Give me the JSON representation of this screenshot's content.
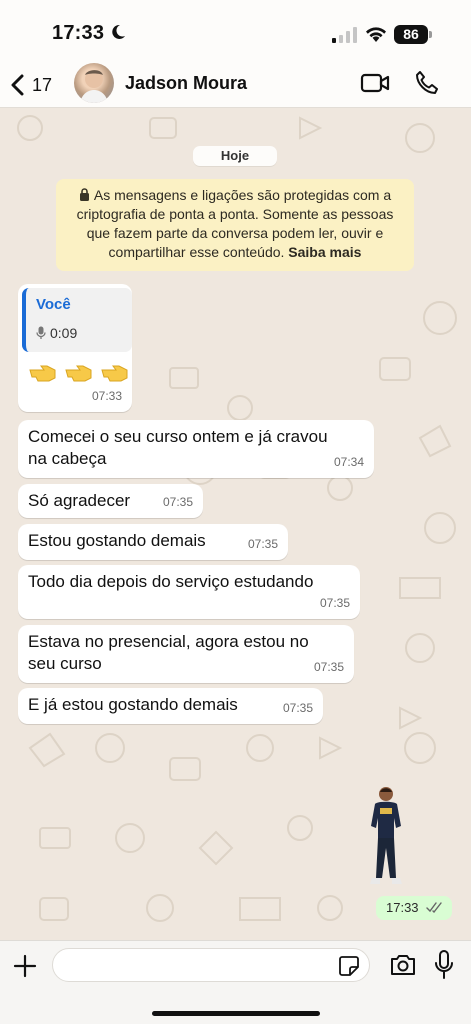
{
  "status": {
    "time": "17:33",
    "battery": "86"
  },
  "header": {
    "back_count": "17",
    "contact_name": "Jadson Moura"
  },
  "chat": {
    "date": "Hoje",
    "encryption_text": "As mensagens e ligações são protegidas com a criptografia de ponta a ponta. Somente as pessoas que fazem parte da conversa podem ler, ouvir e compartilhar esse conteúdo.",
    "encryption_link": "Saiba mais",
    "reply_message": {
      "quoted_name": "Você",
      "quoted_audio": "0:09",
      "time": "07:33"
    },
    "messages": [
      {
        "line1": "Comecei o seu curso ontem e já cravou",
        "line2": "na cabeça",
        "time": "07:34"
      },
      {
        "text": "Só agradecer",
        "time": "07:35"
      },
      {
        "text": "Estou gostando demais",
        "time": "07:35"
      },
      {
        "text": "Todo dia depois do serviço estudando",
        "time": "07:35"
      },
      {
        "line1": "Estava no presencial, agora estou no",
        "line2": "seu curso",
        "time": "07:35"
      },
      {
        "text": "E já estou gostando demais",
        "time": "07:35"
      }
    ],
    "sticker_time": "17:33"
  },
  "input": {
    "value": "",
    "placeholder": ""
  },
  "colors": {
    "accent_blue": "#1a6bd6",
    "outgoing_bubble": "#d9fdd3",
    "encryption_bg": "#fbf1c4",
    "chat_bg": "#efe7de"
  }
}
